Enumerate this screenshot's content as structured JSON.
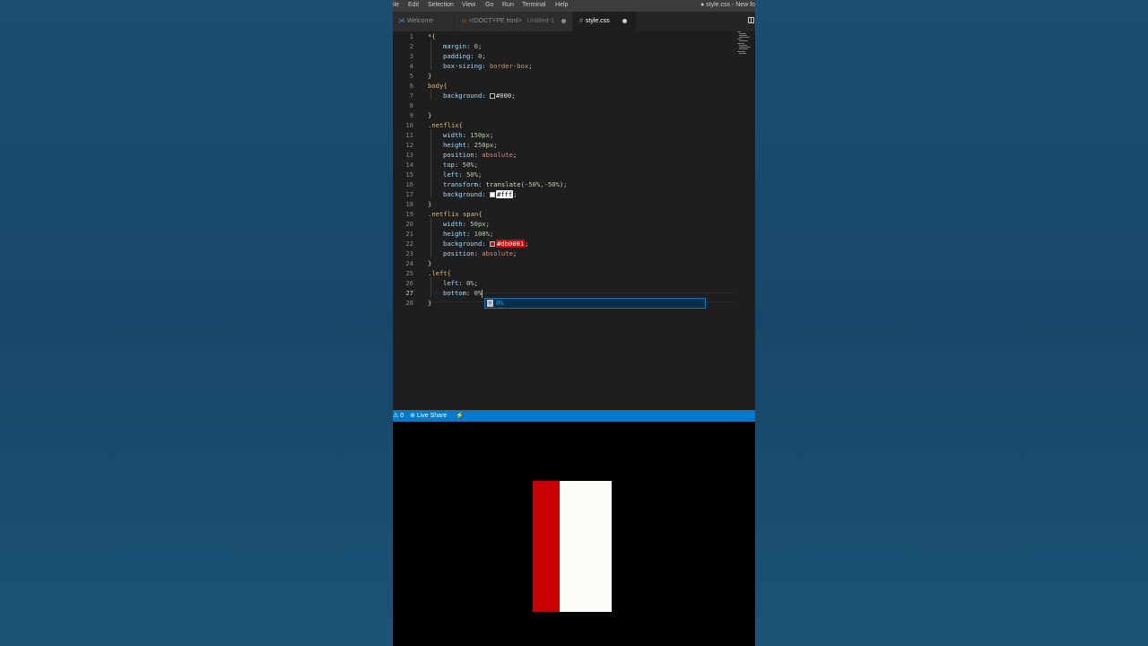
{
  "colors": {
    "accent": "#007acc",
    "netflix_red": "#db0001",
    "box_white": "#ffffff",
    "preview_bg": "#000000"
  },
  "menubar": {
    "items": [
      "ile",
      "Edit",
      "Selection",
      "View",
      "Go",
      "Run",
      "Terminal",
      "Help"
    ],
    "title": "● style.css - New fo"
  },
  "tabs": [
    {
      "label": "Welcome",
      "icon": "vscode-icon"
    },
    {
      "label": "<!DOCTYPE html>",
      "sublabel": "Untitled-1",
      "icon": "html-icon",
      "modified": true
    },
    {
      "label": "style.css",
      "icon": "css-hash-icon",
      "modified": true,
      "active": true
    }
  ],
  "editor": {
    "line_numbers": [
      "1",
      "2",
      "3",
      "4",
      "5",
      "6",
      "7",
      "8",
      "9",
      "10",
      "11",
      "12",
      "13",
      "14",
      "15",
      "16",
      "17",
      "18",
      "19",
      "20",
      "21",
      "22",
      "23",
      "24",
      "25",
      "26",
      "27",
      "28"
    ],
    "l1": "*{",
    "l2p": "margin",
    "l2v": "0",
    "l3p": "padding",
    "l3v": "0",
    "l4p": "box-sizing",
    "l4v": "border-box",
    "l5": "}",
    "l6": "body{",
    "l7p": "background",
    "l7v": "#000",
    "l9": "}",
    "l10": ".netflix{",
    "l11p": "width",
    "l11v": "150px",
    "l12p": "height",
    "l12v": "250px",
    "l13p": "position",
    "l13v": "absolute",
    "l14p": "top",
    "l14v": "50%",
    "l15p": "left",
    "l15v": "50%",
    "l16p": "transform",
    "l16f": "translate",
    "l16v": "-50%,-50%",
    "l17p": "background",
    "l17v": "#fff",
    "l18": "}",
    "l19": ".netflix span{",
    "l20p": "width",
    "l20v": "50px",
    "l21p": "height",
    "l21v": "100%",
    "l22p": "background",
    "l22v": "#db0001",
    "l23p": "position",
    "l23v": "absolute",
    "l24": "}",
    "l25": ".left{",
    "l26p": "left",
    "l26v": "0%",
    "l27p": "bottom",
    "l27v": "0%",
    "l28": "}",
    "suggestion": "0%"
  },
  "statusbar": {
    "problems": "⚠ 0",
    "live_share": "Live Share",
    "branch_icon": "⚡"
  }
}
